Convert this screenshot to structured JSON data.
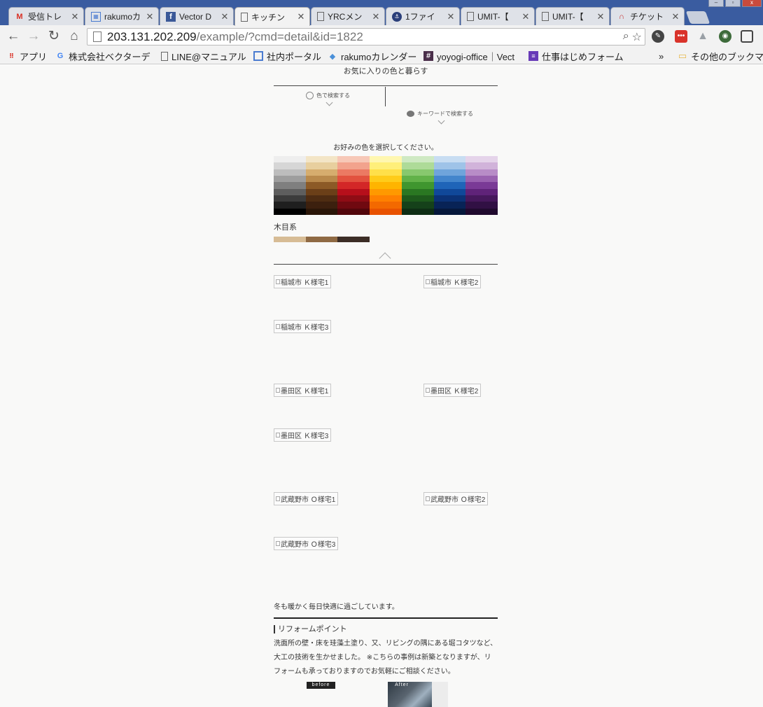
{
  "browser": {
    "tabs": [
      {
        "icon": "gmail-icon",
        "title": "受信トレ",
        "active": false
      },
      {
        "icon": "calendar-icon",
        "title": "rakumoカ",
        "active": false
      },
      {
        "icon": "facebook-icon",
        "title": "Vector D",
        "active": false
      },
      {
        "icon": "page-icon",
        "title": "キッチン",
        "active": true
      },
      {
        "icon": "page-icon",
        "title": "YRCメン",
        "active": false
      },
      {
        "icon": "ship-icon",
        "title": "1ファイ",
        "active": false
      },
      {
        "icon": "page-icon",
        "title": "UMIT-【",
        "active": false
      },
      {
        "icon": "page-icon",
        "title": "UMIT-【",
        "active": false
      },
      {
        "icon": "ticket-icon",
        "title": "チケット",
        "active": false
      }
    ],
    "url_host": "203.131.202.209",
    "url_path": "/example/?cmd=detail&id=1822",
    "bookmarks": [
      {
        "icon": "apps-icon",
        "label": "アプリ"
      },
      {
        "icon": "google-icon",
        "label": "株式会社ベクターデ"
      },
      {
        "icon": "page-icon",
        "label": "LINE@マニュアル"
      },
      {
        "icon": "portal-icon",
        "label": "社内ポータル"
      },
      {
        "icon": "rakumo-icon",
        "label": "rakumoカレンダー"
      },
      {
        "icon": "slack-icon",
        "label": "yoyogi-office｜Vect"
      },
      {
        "icon": "form-icon",
        "label": "仕事はじめフォーム"
      },
      {
        "icon": "folder-icon",
        "label": "その他のブックマー"
      }
    ],
    "overflow": "»",
    "colors": {
      "tabstrip": "#3a5ca0",
      "toolbar": "#f2f2f2"
    }
  },
  "page": {
    "hero_text": "お気に入りの色と暮らす",
    "search_color_label": "色で検索する",
    "search_keyword_label": "キーワードで検索する",
    "prompt": "お好みの色を選択してください。",
    "palette": [
      [
        "#eeeeee",
        "#d6d6d6",
        "#bdbdbd",
        "#9e9e9e",
        "#7f7f7f",
        "#5e5e5e",
        "#3c3c3c",
        "#1f1f1f",
        "#000000"
      ],
      [
        "#f3e5c6",
        "#e8cf9e",
        "#d6ad6e",
        "#b98a4c",
        "#8c5a26",
        "#6b3f18",
        "#4e2c12",
        "#3c200e",
        "#2a1608"
      ],
      [
        "#f7c8b7",
        "#f2a38d",
        "#eb7a63",
        "#e2523f",
        "#d32727",
        "#b60f1b",
        "#8f0c15",
        "#700910",
        "#52060b"
      ],
      [
        "#fff7b0",
        "#ffef7a",
        "#ffe04a",
        "#ffcc1a",
        "#ffb400",
        "#ff9900",
        "#ff8000",
        "#f36900",
        "#e85200"
      ],
      [
        "#cfe9c3",
        "#aedb98",
        "#88c86e",
        "#62b249",
        "#3f962f",
        "#2a7722",
        "#1e5a1c",
        "#15411a",
        "#0e2d14"
      ],
      [
        "#c8ddf2",
        "#9fc3e8",
        "#6fa4db",
        "#4385cc",
        "#1f64b8",
        "#104899",
        "#0b3276",
        "#082356",
        "#06183b"
      ],
      [
        "#e5d4ea",
        "#d1b3da",
        "#b88cc7",
        "#9a62b0",
        "#7a3a96",
        "#5f2379",
        "#46185c",
        "#311044",
        "#200a2e"
      ]
    ],
    "wood_label": "木目系",
    "wood_colors": [
      "#d7bc95",
      "#8f6a44",
      "#3c2d26"
    ],
    "gallery": [
      "稲城市 Ｋ様宅1",
      "稲城市 Ｋ様宅2",
      "稲城市 Ｋ様宅3",
      "墨田区 Ｋ様宅1",
      "墨田区 Ｋ様宅2",
      "墨田区 Ｋ様宅3",
      "武蔵野市 Ｏ様宅1",
      "武蔵野市 Ｏ様宅2",
      "武蔵野市 Ｏ様宅3"
    ],
    "caption": "冬も暖かく毎日快適に過ごしています。",
    "reform_title": "リフォームポイント",
    "reform_body": "洗面所の壁・床を珪藻土塗り、又、リビングの隅にある堀コタツなど、大工の技術を生かせました。 ※こちらの事例は新築となりますが、リフォームも承っておりますのでお気軽にご相談ください。",
    "before_label": "before",
    "after_label": "After"
  }
}
